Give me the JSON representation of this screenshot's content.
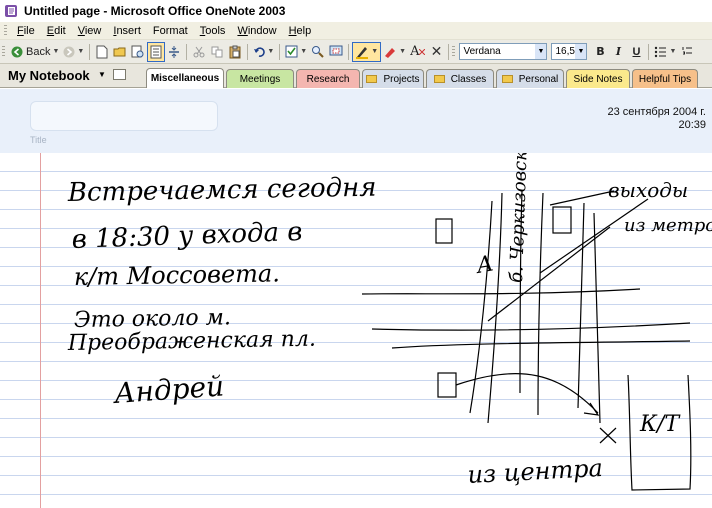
{
  "window": {
    "title": "Untitled page - Microsoft Office OneNote 2003"
  },
  "menu": [
    {
      "key": "F",
      "rest": "ile"
    },
    {
      "key": "E",
      "rest": "dit"
    },
    {
      "key": "V",
      "rest": "iew"
    },
    {
      "key": "I",
      "rest": "nsert"
    },
    {
      "key": "",
      "rest": "Format"
    },
    {
      "key": "T",
      "rest": "ools"
    },
    {
      "key": "W",
      "rest": "indow"
    },
    {
      "key": "H",
      "rest": "elp"
    }
  ],
  "toolbar": {
    "back_label": "Back",
    "font_name": "Verdana",
    "font_size": "16,5",
    "bold": "B",
    "italic": "I",
    "underline": "U",
    "pen_color": "#e8b000",
    "highlighter_color": "#d93a3a",
    "clear_format_label": "A",
    "close_glyph": "✕"
  },
  "notebook": {
    "name": "My Notebook",
    "tabs": [
      {
        "label": "Miscellaneous",
        "color": "#ffffff",
        "folder": false,
        "selected": true
      },
      {
        "label": "Meetings",
        "color": "#c8e6a2",
        "folder": false,
        "selected": false
      },
      {
        "label": "Research",
        "color": "#f4b6b0",
        "folder": false,
        "selected": false
      },
      {
        "label": "Projects",
        "color": "#d5dde9",
        "folder": true,
        "selected": false
      },
      {
        "label": "Classes",
        "color": "#d5dde9",
        "folder": true,
        "selected": false
      },
      {
        "label": "Personal",
        "color": "#d5dde9",
        "folder": true,
        "selected": false
      },
      {
        "label": "Side Notes",
        "color": "#fbe98c",
        "folder": false,
        "selected": false
      },
      {
        "label": "Helpful Tips",
        "color": "#f6c08a",
        "folder": false,
        "selected": false
      }
    ]
  },
  "page": {
    "title_placeholder": "Title",
    "date": "23 сентября 2004 г.",
    "time": "20:39"
  },
  "ink": {
    "note_lines": [
      "Встречаемся сегодня",
      "в 18:30 у входа в",
      "к/т Моссовета.",
      "Это около м.",
      "Преображенская пл.",
      "Андрей"
    ],
    "map_labels": {
      "exits": "выходы",
      "from_metro": "из метро",
      "street": "б. Черкизовская",
      "letter_a": "А",
      "cinema": "К/Т",
      "from_center": "из центра"
    }
  }
}
